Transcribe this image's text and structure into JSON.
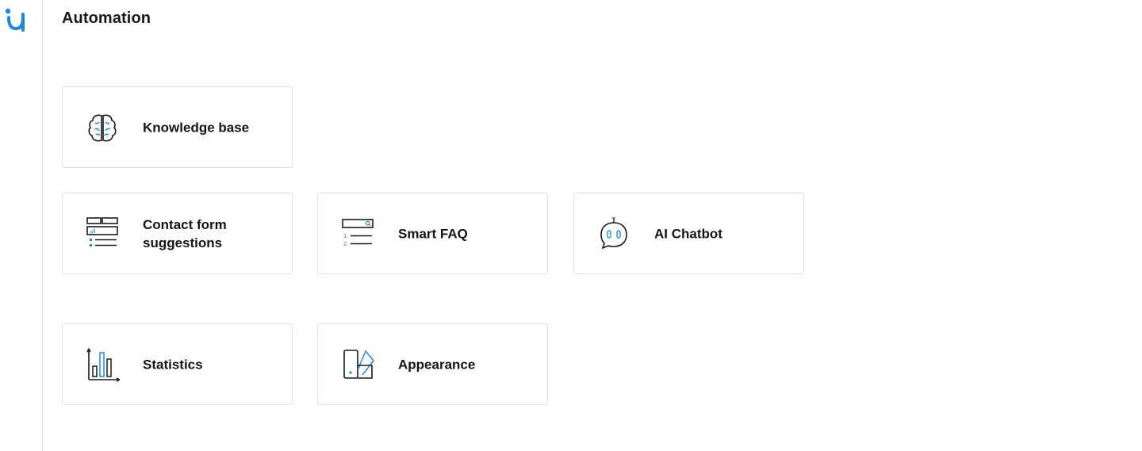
{
  "brand": {
    "accent": "#1e88e5",
    "icon_stroke": "#1a1a1a",
    "card_border": "#e0e0e0"
  },
  "header": {
    "title": "Automation"
  },
  "cards": [
    {
      "id": "knowledge-base",
      "label": "Knowledge base",
      "icon": "brain-icon"
    },
    {
      "id": "contact-form-suggestions",
      "label": "Contact form suggestions",
      "icon": "form-list-icon"
    },
    {
      "id": "smart-faq",
      "label": "Smart FAQ",
      "icon": "numbered-list-search-icon"
    },
    {
      "id": "ai-chatbot",
      "label": "AI Chatbot",
      "icon": "robot-chat-icon"
    },
    {
      "id": "statistics",
      "label": "Statistics",
      "icon": "bar-chart-icon"
    },
    {
      "id": "appearance",
      "label": "Appearance",
      "icon": "palette-swatch-icon"
    }
  ]
}
